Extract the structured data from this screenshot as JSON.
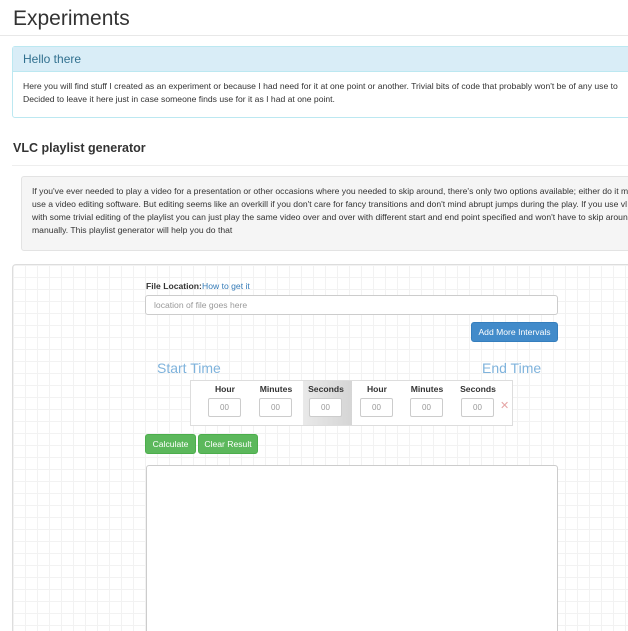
{
  "page": {
    "title": "Experiments"
  },
  "intro_panel": {
    "heading": "Hello there",
    "line1": "Here you will find stuff I created as an experiment or because I had need for it at one point or another. Trivial bits of code that probably won't be of any use to",
    "line2": "Decided to leave it here just in case someone finds use for it as I had at one point."
  },
  "section": {
    "title": "VLC playlist generator"
  },
  "description": {
    "line1": "If you've ever needed to play a video for a presentation or other occasions where you needed to skip around, there's only two options available; either do it ma",
    "line2": "use a video editing software. But editing seems like an overkill if you don't care for fancy transitions and don't mind abrupt jumps during the play. If you use vl",
    "line3": "with some trivial editing of the playlist you can just play the same video over and over with different start and end point specified and won't have to skip aroun",
    "line4": "manually. This playlist generator will help you do that"
  },
  "form": {
    "file_label": "File Location:",
    "help_link": "How to get it",
    "file_placeholder": "location of file goes here",
    "add_button": "Add More Intervals",
    "start_heading": "Start Time",
    "end_heading": "End Time",
    "columns": [
      "Hour",
      "Minutes",
      "Seconds",
      "Hour",
      "Minutes",
      "Seconds"
    ],
    "time_placeholder": "00",
    "remove_symbol": "✕",
    "calculate_button": "Calculate",
    "clear_button": "Clear Result"
  },
  "colors": {
    "info_header_bg": "#d9edf7",
    "primary": "#428bca",
    "success": "#5cb85c",
    "time_heading": "#7fb3dc"
  },
  "icons": {
    "remove": "close-icon"
  }
}
